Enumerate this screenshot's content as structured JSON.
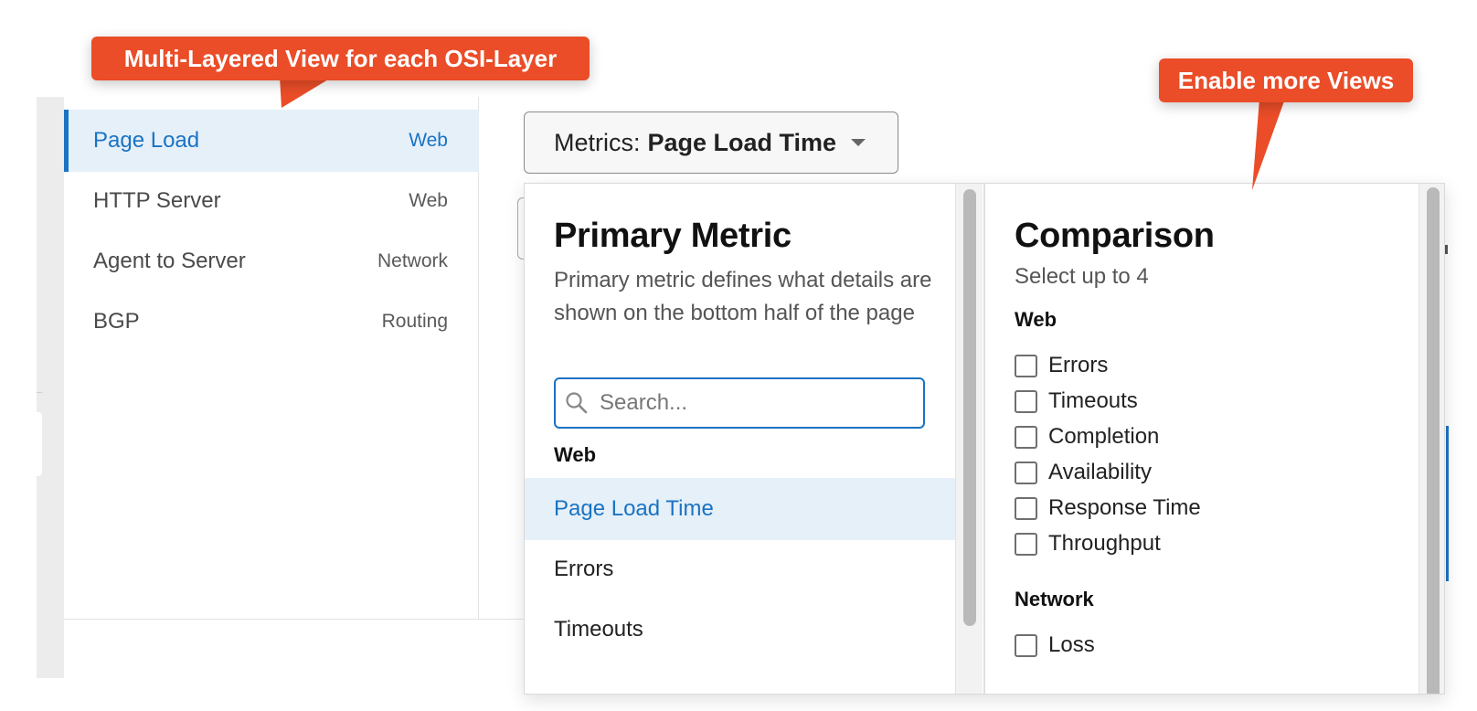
{
  "callouts": {
    "layers": "Multi-Layered View for each OSI-Layer",
    "views": "Enable more Views"
  },
  "colors": {
    "accent": "#1a73c2",
    "callout": "#ea4d28",
    "selected_bg": "#e5f0f9"
  },
  "layers": [
    {
      "label": "Page Load",
      "category": "Web",
      "active": true
    },
    {
      "label": "HTTP Server",
      "category": "Web",
      "active": false
    },
    {
      "label": "Agent to Server",
      "category": "Network",
      "active": false
    },
    {
      "label": "BGP",
      "category": "Routing",
      "active": false
    }
  ],
  "metrics_button": {
    "prefix": "Metrics:",
    "value": "Page Load Time",
    "icon": "caret-down-icon"
  },
  "primary": {
    "title": "Primary Metric",
    "description": "Primary metric defines what details are shown on the bottom half of the page",
    "search_placeholder": "Search...",
    "search_icon": "search-icon",
    "section": "Web",
    "items": [
      {
        "label": "Page Load Time",
        "selected": true
      },
      {
        "label": "Errors",
        "selected": false
      },
      {
        "label": "Timeouts",
        "selected": false
      }
    ]
  },
  "comparison": {
    "title": "Comparison",
    "subtitle": "Select up to 4",
    "sections": [
      {
        "name": "Web",
        "items": [
          "Errors",
          "Timeouts",
          "Completion",
          "Availability",
          "Response Time",
          "Throughput"
        ]
      },
      {
        "name": "Network",
        "items": [
          "Loss"
        ]
      }
    ]
  }
}
